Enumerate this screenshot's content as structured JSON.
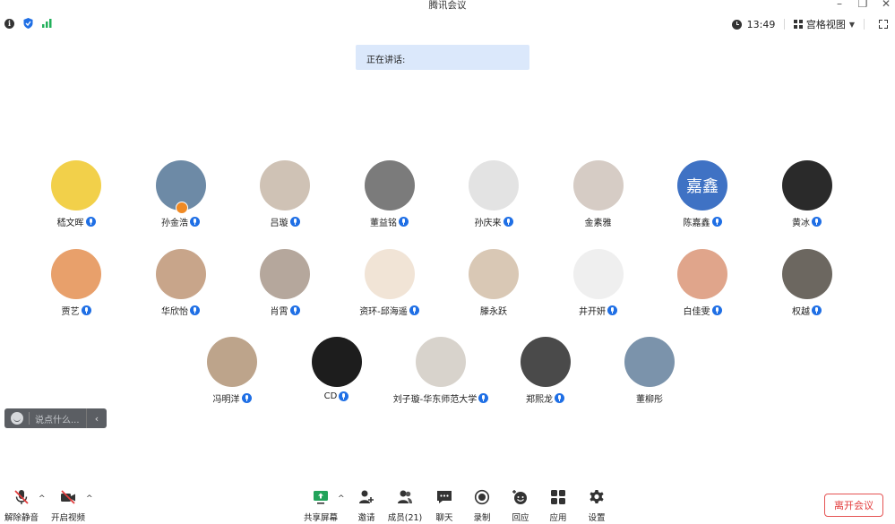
{
  "app": {
    "title": "腾讯会议"
  },
  "window": {
    "minimize_icon": "minimize-icon",
    "restore_icon": "restore-icon",
    "close_icon": "close-icon"
  },
  "topbar": {
    "left_icons": [
      "info-icon",
      "shield-icon",
      "signal-icon"
    ],
    "time": "13:49",
    "view_label": "宫格视图"
  },
  "speaking": {
    "label": "正在讲话:"
  },
  "participants": [
    {
      "name": "嵇文晖",
      "mic": true,
      "avatar_color": "#f2d04a"
    },
    {
      "name": "孙金浩",
      "mic": true,
      "host": true,
      "avatar_color": "#6d8aa6"
    },
    {
      "name": "吕璇",
      "mic": true,
      "avatar_color": "#cfc2b5"
    },
    {
      "name": "董益铭",
      "mic": true,
      "avatar_color": "#7b7b7b"
    },
    {
      "name": "孙庆来",
      "mic": true,
      "avatar_color": "#e3e3e3"
    },
    {
      "name": "金素雅",
      "mic": false,
      "avatar_color": "#d6ccc5"
    },
    {
      "name": "陈嘉鑫",
      "mic": true,
      "avatar_color": "#3f72c4",
      "avatar_text": "嘉鑫"
    },
    {
      "name": "黄冰",
      "mic": true,
      "avatar_color": "#2a2a2a"
    },
    {
      "name": "贾艺",
      "mic": true,
      "avatar_color": "#e8a06b"
    },
    {
      "name": "华欣怡",
      "mic": true,
      "avatar_color": "#c8a58a"
    },
    {
      "name": "肖霄",
      "mic": true,
      "avatar_color": "#b5a79c"
    },
    {
      "name": "资环-邱海遥",
      "mic": true,
      "avatar_color": "#f1e4d6"
    },
    {
      "name": "滕永跃",
      "mic": false,
      "avatar_color": "#d9c8b5"
    },
    {
      "name": "井开妍",
      "mic": true,
      "avatar_color": "#efefef"
    },
    {
      "name": "白佳雯",
      "mic": true,
      "avatar_color": "#e0a58b"
    },
    {
      "name": "权越",
      "mic": true,
      "avatar_color": "#6c6760"
    },
    {
      "name": "冯明洋",
      "mic": true,
      "avatar_color": "#bda48b"
    },
    {
      "name": "CD",
      "mic": true,
      "avatar_color": "#1d1d1d"
    },
    {
      "name": "刘子璇-华东师范大学",
      "mic": true,
      "avatar_color": "#d8d3cc"
    },
    {
      "name": "郑熙龙",
      "mic": true,
      "avatar_color": "#4a4a4a"
    },
    {
      "name": "董柳彤",
      "mic": false,
      "avatar_color": "#7b93ab"
    }
  ],
  "chat": {
    "placeholder": "说点什么..."
  },
  "toolbar": {
    "unmute": "解除静音",
    "start_video": "开启视频",
    "share": "共享屏幕",
    "invite": "邀请",
    "members": "成员(21)",
    "chat": "聊天",
    "record": "录制",
    "react": "回应",
    "apps": "应用",
    "settings": "设置",
    "leave": "离开会议"
  },
  "colors": {
    "mic_blue": "#1f6fe5",
    "leave_red": "#e23b3b",
    "banner": "#dbe8fb"
  }
}
